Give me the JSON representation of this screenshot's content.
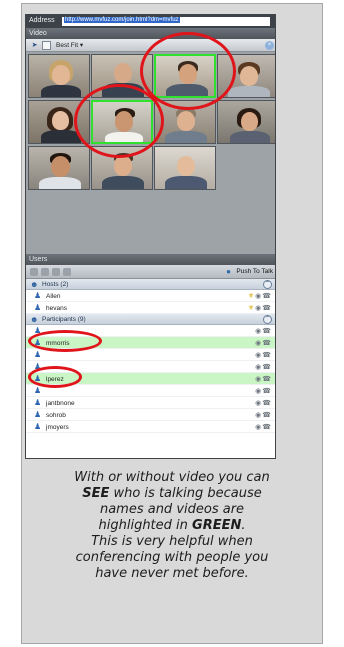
{
  "window": {
    "address_label": "Address",
    "address_value": "http://www.mvfuz.com/join.html?dm=mvfuz",
    "video_panel_title": "Video",
    "users_panel_title": "Users"
  },
  "video_toolbar": {
    "layout_label": "Best Fit ▾",
    "icons": [
      "pointer-icon",
      "grid-icon",
      "close-icon"
    ]
  },
  "video_tiles": [
    {
      "active": false
    },
    {
      "active": false
    },
    {
      "active": true
    },
    {
      "active": false
    },
    {
      "active": false
    },
    {
      "active": false
    },
    {
      "active": true
    },
    {
      "active": false
    },
    {
      "active": false
    },
    {
      "active": false
    },
    {
      "active": false
    },
    {
      "active": false
    },
    {
      "active": false
    }
  ],
  "users_toolbar": {
    "push_to_talk_label": "Push To Talk"
  },
  "users": {
    "hosts_group_label": "Hosts (2)",
    "hosts": [
      {
        "name": "Allen"
      },
      {
        "name": "hevans"
      }
    ],
    "participants_group_label": "Participants (9)",
    "participants": [
      {
        "name": "",
        "talking": false
      },
      {
        "name": "mmorris",
        "talking": true
      },
      {
        "name": "",
        "talking": false
      },
      {
        "name": "",
        "talking": false
      },
      {
        "name": "lperez",
        "talking": true
      },
      {
        "name": "",
        "talking": false
      },
      {
        "name": "jantbnone",
        "talking": false
      },
      {
        "name": "sohrob",
        "talking": false
      },
      {
        "name": "jmoyers",
        "talking": false
      }
    ]
  },
  "caption": {
    "line1": "With or without video you can",
    "see_word": "SEE",
    "line2": " who is talking because",
    "line3": "names and videos are",
    "line4a": "highlighted in ",
    "green_word": "GREEN",
    "line4b": ".",
    "line5": "This is very helpful when",
    "line6": "conferencing with people you",
    "line7": "have never met before."
  },
  "colors": {
    "talking_highlight": "#c9f6c4",
    "active_video_border": "#2fe02f",
    "annotation_circle": "#e0141b"
  }
}
